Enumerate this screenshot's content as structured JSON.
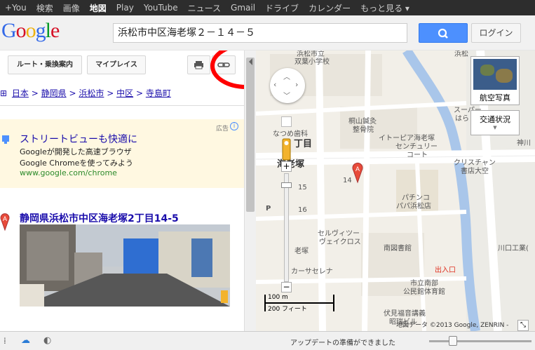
{
  "gbar": {
    "items": [
      "+You",
      "検索",
      "画像",
      "地図",
      "Play",
      "YouTube",
      "ニュース",
      "Gmail",
      "ドライブ",
      "カレンダー",
      "もっと見る ▾"
    ],
    "current_index": 3
  },
  "header": {
    "logo": "Google",
    "search_value": "浜松市中区海老塚２－１４－５",
    "login_label": "ログイン"
  },
  "toolbar": {
    "route_label": "ルート・乗換案内",
    "myplaces_label": "マイプレイス"
  },
  "breadcrumb": {
    "items": [
      "日本",
      "静岡県",
      "浜松市",
      "中区",
      "寺島町"
    ],
    "separator": ">"
  },
  "ad": {
    "label": "広告",
    "title": "ストリートビューも快適に",
    "line1": "Googleが開発した高速ブラウザ",
    "line2": "Google Chromeを使ってみよう",
    "url": "www.google.com/chrome"
  },
  "result": {
    "marker": "A",
    "title": "静岡県浜松市中区海老塚2丁目14-5"
  },
  "map": {
    "satellite_label": "航空写真",
    "traffic_label": "交通状況",
    "labels": [
      "浜松市立",
      "双葉小学校",
      "浜松",
      "桐山鍼灸",
      "整骨院",
      "イトーピア海老塚",
      "センチュリー",
      "コート",
      "スーパー",
      "はら",
      "クリスチャン",
      "書店大空",
      "神川",
      "なつめ歯科",
      "丁目",
      "海老塚",
      "14",
      "15",
      "16",
      "パチンコ",
      "パパ浜松店",
      "セルヴィツー",
      "ヴェイクロス",
      "南図書館",
      "老塚",
      "カーサセレナ",
      "市立南部",
      "公民館体育館",
      "川口工業(",
      "出入口",
      "伏見福音講義",
      "昭瑞ビル",
      "P"
    ],
    "scale_m": "100 m",
    "scale_ft": "200 フィート",
    "copyright": "地図データ ©2013 Google, ZENRIN -",
    "marker": "A"
  },
  "status": {
    "text": "アップデートの準備ができました"
  },
  "colors": {
    "link": "#1a0dab",
    "accent": "#4d90fe",
    "circle": "#ff0000",
    "ad_bg": "#fff8e1",
    "result_title": "#1a0dab"
  }
}
